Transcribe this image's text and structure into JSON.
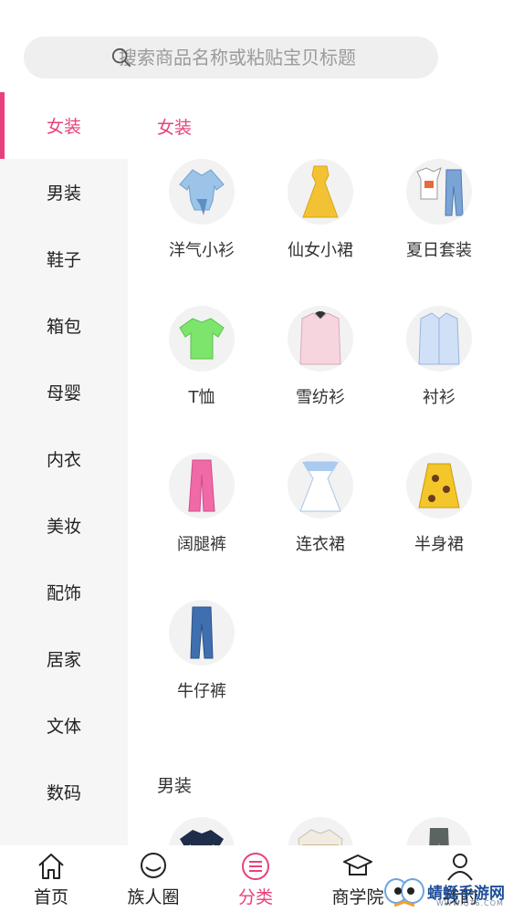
{
  "search": {
    "placeholder": "搜索商品名称或粘贴宝贝标题"
  },
  "sidebar": {
    "items": [
      {
        "label": "女装"
      },
      {
        "label": "男装"
      },
      {
        "label": "鞋子"
      },
      {
        "label": "箱包"
      },
      {
        "label": "母婴"
      },
      {
        "label": "内衣"
      },
      {
        "label": "美妆"
      },
      {
        "label": "配饰"
      },
      {
        "label": "居家"
      },
      {
        "label": "文体"
      },
      {
        "label": "数码"
      }
    ]
  },
  "sections": [
    {
      "title": "女装",
      "items": [
        {
          "label": "洋气小衫",
          "icon": "blouse-icon"
        },
        {
          "label": "仙女小裙",
          "icon": "dress-icon"
        },
        {
          "label": "夏日套装",
          "icon": "outfit-icon"
        },
        {
          "label": "T恤",
          "icon": "tshirt-icon"
        },
        {
          "label": "雪纺衫",
          "icon": "chiffon-shirt-icon"
        },
        {
          "label": "衬衫",
          "icon": "shirt-icon"
        },
        {
          "label": "阔腿裤",
          "icon": "wide-pants-icon"
        },
        {
          "label": "连衣裙",
          "icon": "one-piece-dress-icon"
        },
        {
          "label": "半身裙",
          "icon": "skirt-icon"
        },
        {
          "label": "牛仔裤",
          "icon": "jeans-icon"
        }
      ]
    },
    {
      "title": "男装"
    }
  ],
  "bottom_nav": {
    "items": [
      {
        "label": "首页",
        "icon": "home-icon"
      },
      {
        "label": "族人圈",
        "icon": "chat-bubble-icon"
      },
      {
        "label": "分类",
        "icon": "category-icon"
      },
      {
        "label": "商学院",
        "icon": "graduation-cap-icon"
      },
      {
        "label": "我的",
        "icon": "user-icon"
      }
    ]
  },
  "watermark": {
    "text": "蜻蜓手游网",
    "sub": "WWW.QT6.COM"
  },
  "colors": {
    "accent": "#e8407c",
    "sidebar_bg": "#f6f6f6",
    "search_bg": "#efefef"
  }
}
